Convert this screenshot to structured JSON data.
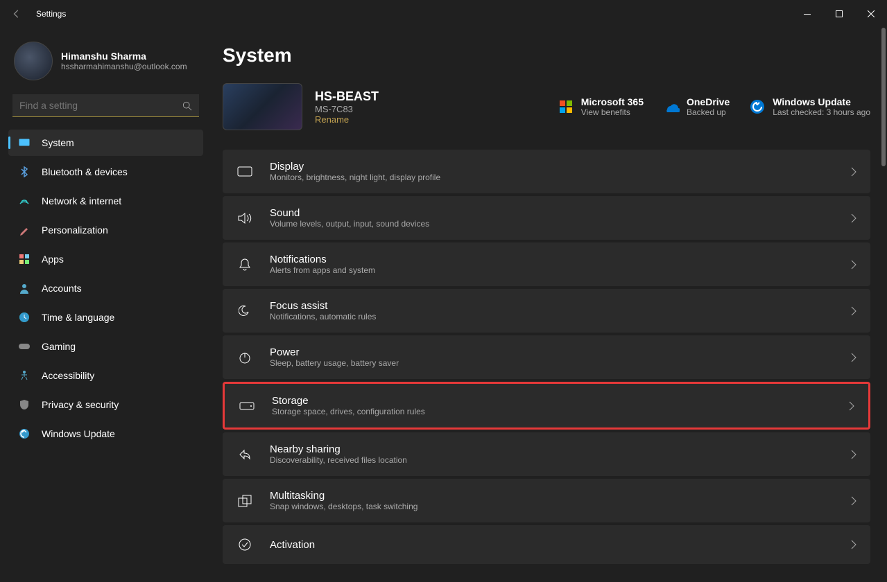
{
  "window": {
    "title": "Settings"
  },
  "user": {
    "name": "Himanshu Sharma",
    "email": "hssharmahimanshu@outlook.com"
  },
  "search": {
    "placeholder": "Find a setting"
  },
  "nav": [
    {
      "label": "System",
      "active": true
    },
    {
      "label": "Bluetooth & devices"
    },
    {
      "label": "Network & internet"
    },
    {
      "label": "Personalization"
    },
    {
      "label": "Apps"
    },
    {
      "label": "Accounts"
    },
    {
      "label": "Time & language"
    },
    {
      "label": "Gaming"
    },
    {
      "label": "Accessibility"
    },
    {
      "label": "Privacy & security"
    },
    {
      "label": "Windows Update"
    }
  ],
  "page": {
    "heading": "System",
    "device": {
      "name": "HS-BEAST",
      "model": "MS-7C83",
      "rename": "Rename"
    },
    "status": {
      "m365": {
        "title": "Microsoft 365",
        "sub": "View benefits"
      },
      "onedrive": {
        "title": "OneDrive",
        "sub": "Backed up"
      },
      "update": {
        "title": "Windows Update",
        "sub": "Last checked: 3 hours ago"
      }
    },
    "items": [
      {
        "title": "Display",
        "sub": "Monitors, brightness, night light, display profile"
      },
      {
        "title": "Sound",
        "sub": "Volume levels, output, input, sound devices"
      },
      {
        "title": "Notifications",
        "sub": "Alerts from apps and system"
      },
      {
        "title": "Focus assist",
        "sub": "Notifications, automatic rules"
      },
      {
        "title": "Power",
        "sub": "Sleep, battery usage, battery saver"
      },
      {
        "title": "Storage",
        "sub": "Storage space, drives, configuration rules",
        "highlighted": true
      },
      {
        "title": "Nearby sharing",
        "sub": "Discoverability, received files location"
      },
      {
        "title": "Multitasking",
        "sub": "Snap windows, desktops, task switching"
      },
      {
        "title": "Activation",
        "sub": ""
      }
    ]
  }
}
